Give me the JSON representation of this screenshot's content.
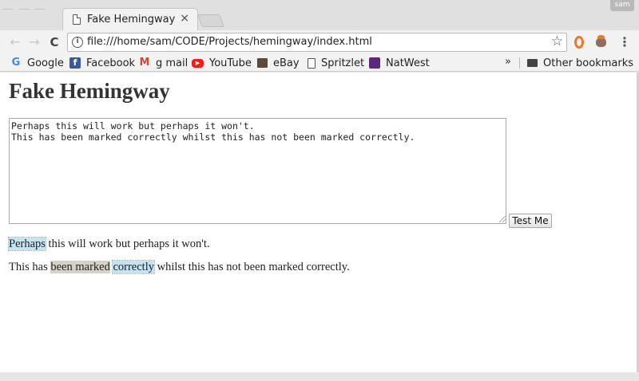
{
  "browser": {
    "tab_title": "Fake Hemingway",
    "tab_close": "×",
    "user_chip": "sam",
    "url": "file:///home/sam/CODE/Projects/hemingway/index.html",
    "nav": {
      "back": "←",
      "forward": "→",
      "reload": "C"
    }
  },
  "bookmarks": [
    {
      "label": "Google",
      "icon": "G"
    },
    {
      "label": "Facebook",
      "icon": "f"
    },
    {
      "label": "g mail",
      "icon": "M"
    },
    {
      "label": "YouTube",
      "icon": "▶"
    },
    {
      "label": "eBay",
      "icon": ""
    },
    {
      "label": "Spritzlet",
      "icon": ""
    },
    {
      "label": "NatWest",
      "icon": ""
    }
  ],
  "bookmarks_overflow": "»",
  "other_bookmarks": "Other bookmarks",
  "page": {
    "heading": "Fake Hemingway",
    "textarea_value": "Perhaps this will work but perhaps it won't.\nThis has been marked correctly whilst this has not been marked correctly.",
    "button_label": "Test Me",
    "output": {
      "line1": {
        "adverb": "Perhaps",
        "rest": " this will work but perhaps it won't."
      },
      "line2": {
        "before": "This has ",
        "passive": "been marked",
        "space": " ",
        "adverb": "correctly",
        "after": " whilst this has not been marked correctly."
      }
    }
  },
  "colors": {
    "adverb_highlight": "#c4e3f3",
    "passive_highlight": "#d6d2c8",
    "page_background": "#ffffff"
  }
}
